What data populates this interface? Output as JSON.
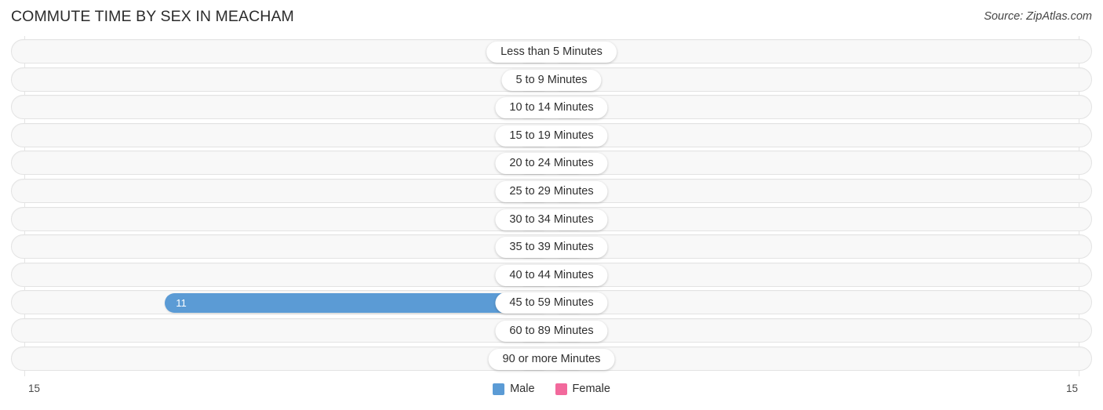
{
  "header": {
    "title": "COMMUTE TIME BY SEX IN MEACHAM",
    "source": "Source: ZipAtlas.com"
  },
  "legend": {
    "male_label": "Male",
    "female_label": "Female",
    "male_color": "#5b9bd5",
    "female_color": "#f2699c"
  },
  "axis": {
    "left_min": "15",
    "right_min": "15"
  },
  "colors": {
    "male_bar": "#a9c9ee",
    "male_bar_active": "#5b9bd5",
    "female_bar": "#f7abc5",
    "female_bar_active": "#f2699c",
    "track": "#f8f8f8",
    "track_border": "#e3e3e3",
    "gridline": "#e4e4e4"
  },
  "chart_data": {
    "type": "bar",
    "title": "COMMUTE TIME BY SEX IN MEACHAM",
    "subtitle": "",
    "xlabel": "",
    "ylabel": "",
    "orientation": "horizontal-diverging",
    "grid": true,
    "legend_position": "bottom-center",
    "axis_max": 15,
    "xlim": [
      15,
      0,
      15
    ],
    "categories": [
      "Less than 5 Minutes",
      "5 to 9 Minutes",
      "10 to 14 Minutes",
      "15 to 19 Minutes",
      "20 to 24 Minutes",
      "25 to 29 Minutes",
      "30 to 34 Minutes",
      "35 to 39 Minutes",
      "40 to 44 Minutes",
      "45 to 59 Minutes",
      "60 to 89 Minutes",
      "90 or more Minutes"
    ],
    "series": [
      {
        "name": "Male",
        "values": [
          0,
          0,
          0,
          0,
          0,
          0,
          0,
          0,
          0,
          11,
          0,
          0
        ]
      },
      {
        "name": "Female",
        "values": [
          0,
          0,
          0,
          0,
          0,
          0,
          0,
          0,
          0,
          0,
          0,
          0
        ]
      }
    ]
  },
  "rows": [
    {
      "label": "Less than 5 Minutes",
      "male": "0",
      "female": "0"
    },
    {
      "label": "5 to 9 Minutes",
      "male": "0",
      "female": "0"
    },
    {
      "label": "10 to 14 Minutes",
      "male": "0",
      "female": "0"
    },
    {
      "label": "15 to 19 Minutes",
      "male": "0",
      "female": "0"
    },
    {
      "label": "20 to 24 Minutes",
      "male": "0",
      "female": "0"
    },
    {
      "label": "25 to 29 Minutes",
      "male": "0",
      "female": "0"
    },
    {
      "label": "30 to 34 Minutes",
      "male": "0",
      "female": "0"
    },
    {
      "label": "35 to 39 Minutes",
      "male": "0",
      "female": "0"
    },
    {
      "label": "40 to 44 Minutes",
      "male": "0",
      "female": "0"
    },
    {
      "label": "45 to 59 Minutes",
      "male": "11",
      "female": "0"
    },
    {
      "label": "60 to 89 Minutes",
      "male": "0",
      "female": "0"
    },
    {
      "label": "90 or more Minutes",
      "male": "0",
      "female": "0"
    }
  ]
}
